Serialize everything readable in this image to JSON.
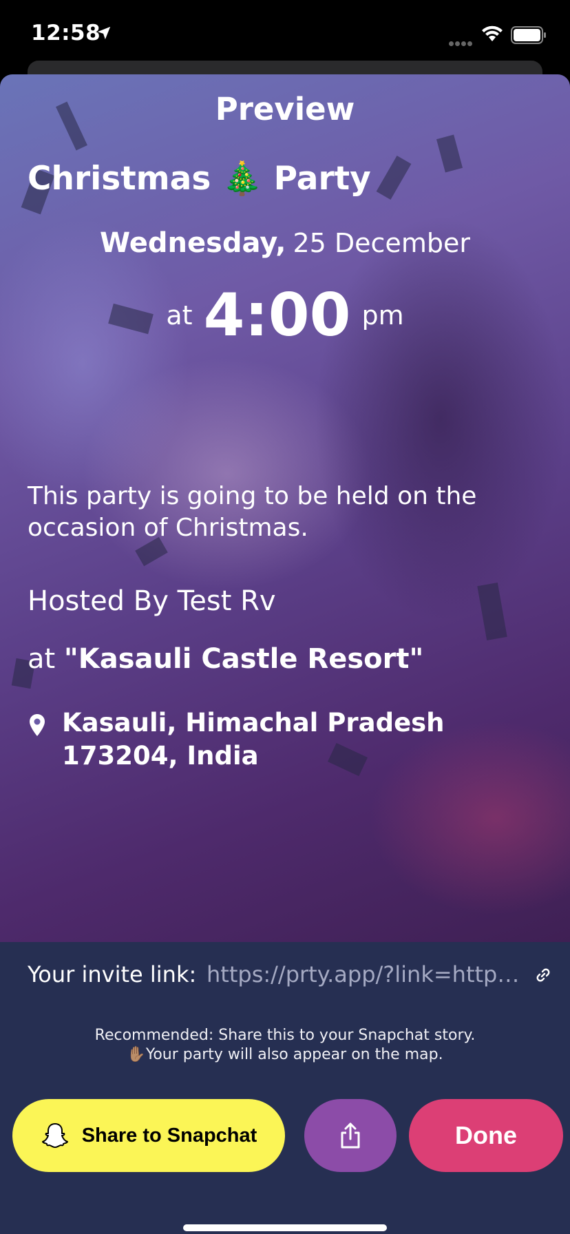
{
  "status_bar": {
    "time": "12:58"
  },
  "preview": {
    "heading": "Preview",
    "party_title": "Christmas 🎄 Party",
    "weekday": "Wednesday,",
    "date": "25 December",
    "at_label": "at",
    "time": "4:00",
    "ampm": "pm",
    "description": "This party is going to be held on the occasion of Christmas.",
    "hosted_by": "Hosted By Test Rv",
    "venue_prefix": "at",
    "venue_name": "\"Kasauli Castle Resort\"",
    "address": "Kasauli, Himachal Pradesh 173204, India"
  },
  "invite": {
    "label": "Your invite link:",
    "url": "https://prty.app/?link=https://prty.app"
  },
  "recommendation": {
    "line1": "Recommended: Share this to your Snapchat story.",
    "line2": "✋🏽Your party will also appear on the map."
  },
  "actions": {
    "snapchat_label": "Share to Snapchat",
    "done_label": "Done"
  },
  "colors": {
    "snap_button": "#fbf556",
    "share_button": "#8c4ca8",
    "done_button": "#dc3f75",
    "panel_bg": "#262f52"
  },
  "icons": [
    "location-arrow-icon",
    "wifi-icon",
    "battery-icon",
    "map-pin-icon",
    "link-icon",
    "snapchat-ghost-icon",
    "share-icon"
  ]
}
